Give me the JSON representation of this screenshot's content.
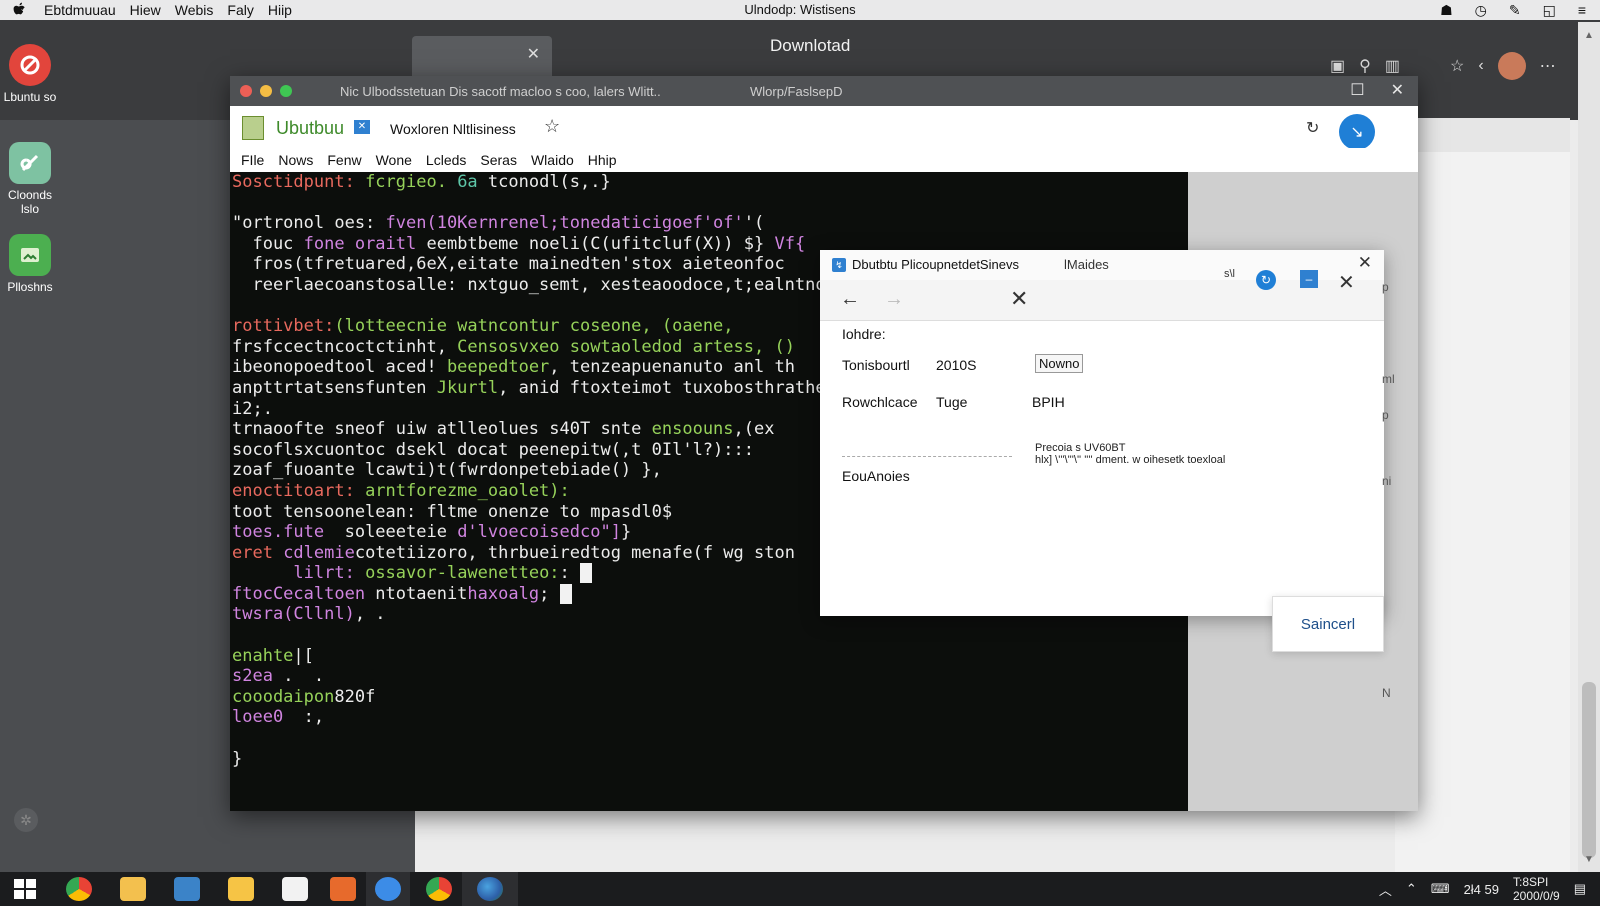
{
  "menubar": {
    "apple": "",
    "items": [
      "Ebtdmuuau",
      "Hiew",
      "Webis",
      "Faly",
      "Hiip"
    ],
    "title": "Ulndodp: Wistisens"
  },
  "desktop": {
    "icons": [
      {
        "label": "Lbuntu so"
      },
      {
        "label": "Cloonds lslo"
      },
      {
        "label": "Plloshns"
      }
    ]
  },
  "browser": {
    "title": "Downlotad"
  },
  "terminal_window": {
    "title": "Nic Ulbodsstetuan Dis sacotf macloo s coo, lalers Wlitt..",
    "subtitle": "Wlorp/FaslsepD",
    "app_name": "Ubutbuu",
    "doc_name": "Woxloren Nltlisiness",
    "menu": [
      "FIle",
      "Nows",
      "Fenw",
      "Wone",
      "Lcleds",
      "Seras",
      "Wlaido",
      "Hhip"
    ],
    "lines": [
      [
        [
          "red",
          "Sosctidpunt:"
        ],
        [
          "green",
          " fcrgieo. "
        ],
        [
          "teal",
          "6a"
        ],
        [
          "white",
          " tconodl(s,.}"
        ]
      ],
      [
        [
          "white",
          ""
        ]
      ],
      [
        [
          "white",
          "\"ortronol oes: "
        ],
        [
          "purple",
          "fven(10Kernrenel;tonedaticigoef'of'"
        ],
        [
          "white",
          "'("
        ]
      ],
      [
        [
          "white",
          "  fouc "
        ],
        [
          "purple",
          "fone oraitl"
        ],
        [
          "white",
          " eembtbeme noeli(C(ufitcluf(X)) $} "
        ],
        [
          "purple",
          "Vf{"
        ]
      ],
      [
        [
          "white",
          "  fros(tfretuared,6eX,eitate mainedten'stox aieteonfoc"
        ]
      ],
      [
        [
          "white",
          "  reerlaecoanstosalle: nxtguo_semt, xesteaoodoce,t;ealntno"
        ]
      ],
      [
        [
          "white",
          ""
        ]
      ],
      [
        [
          "red",
          "rottivbet:"
        ],
        [
          "green",
          "(lotteecnie watncontur coseone, (oaene,"
        ]
      ],
      [
        [
          "white",
          "frsfccectncoctctinht, "
        ],
        [
          "green",
          "Censosvxeo sowtaoledod artess, ()"
        ]
      ],
      [
        [
          "white",
          "ibeonopoedtool aced! "
        ],
        [
          "green",
          "beepedtoer"
        ],
        [
          "white",
          ", tenzeapuenanuto anl th"
        ]
      ],
      [
        [
          "white",
          "anpttrtatsensfunten "
        ],
        [
          "green",
          "Jkurtl"
        ],
        [
          "white",
          ", anid ftoxteimot tuxobosthrathe"
        ]
      ],
      [
        [
          "white",
          "i2;."
        ]
      ],
      [
        [
          "white",
          "trnaoofte sneof uiw atlleolues s40T snte "
        ],
        [
          "green",
          "ensoouns"
        ],
        [
          "white",
          ",(ex"
        ]
      ],
      [
        [
          "white",
          "socoflsxcuontoc dsekl docat peenepitw(,t 0Il'l?)::: "
        ]
      ],
      [
        [
          "white",
          "zoaf_fuoante lcawti)t(fwrdonpetebiade() },"
        ]
      ],
      [
        [
          "red",
          "enoctitoart:"
        ],
        [
          "green",
          " arntforezme_oaolet):"
        ]
      ],
      [
        [
          "white",
          "toot tensoonelean: fltme onenze to mpasdl0$"
        ]
      ],
      [
        [
          "purple",
          "toes.fute"
        ],
        [
          "white",
          "  soleeeteie "
        ],
        [
          "purple",
          "d'lvoecoisedco\"]"
        ],
        [
          "white",
          "}"
        ]
      ],
      [
        [
          "red",
          "eret"
        ],
        [
          "purple",
          " cdlemie"
        ],
        [
          "white",
          "cotetiizoro, thrbueiredtog menafe(f wg ston"
        ]
      ],
      [
        [
          "white",
          "      "
        ],
        [
          "purple",
          "lilrt:"
        ],
        [
          "green",
          " ossavor-lawenetteo:"
        ],
        [
          "white",
          ": "
        ],
        [
          "cursor",
          ""
        ]
      ],
      [
        [
          "purple",
          "ftocCecaltoen"
        ],
        [
          "white",
          " ntotaenit"
        ],
        [
          "purple",
          "haxoalg"
        ],
        [
          "white",
          "; "
        ],
        [
          "cursor",
          ""
        ]
      ],
      [
        [
          "purple",
          "twsra(Cllnl)"
        ],
        [
          "white",
          ", ."
        ]
      ],
      [
        [
          "white",
          ""
        ]
      ],
      [
        [
          "green",
          "enahte"
        ],
        [
          "white",
          "|["
        ]
      ],
      [
        [
          "purple",
          "s2ea"
        ],
        [
          "white",
          " .  ."
        ]
      ],
      [
        [
          "green",
          "cooodaipon"
        ],
        [
          "white",
          "820f"
        ]
      ],
      [
        [
          "purple",
          "loee0"
        ],
        [
          "white",
          "  :,"
        ]
      ],
      [
        [
          "white",
          ""
        ]
      ],
      [
        [
          "white",
          "}"
        ]
      ]
    ]
  },
  "dialog": {
    "title": "Dbutbtu PlicoupnetdetSinevs",
    "subtitle": "lMaides",
    "tool_label": "s\\l",
    "field_heading": "Iohdre:",
    "row1_label": "Tonisbourtl",
    "row1_value": "2010S",
    "row1_select": "Nowno",
    "row2_label": "Rowchlcace",
    "row2_value": "Tuge",
    "row2_extra": "BPIH",
    "row3_label": "EouAnoies",
    "note_line1": "Precoia s UV60BT",
    "note_line2": "hlx] \\'''\\'''\\'' '''' dment. w oihesetk toexloal",
    "submit_label": "Saincerl"
  },
  "side_letters": [
    "p",
    "ml",
    "p",
    "ni",
    "N"
  ],
  "taskbar": {
    "tray_num": "2ł4 59",
    "time": "T:8SPI",
    "date": "2000/0/9"
  }
}
